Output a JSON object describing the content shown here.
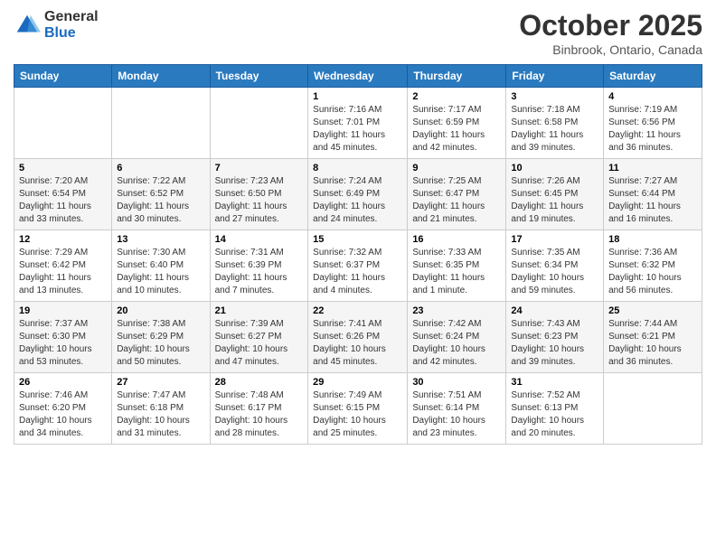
{
  "logo": {
    "general": "General",
    "blue": "Blue"
  },
  "title": "October 2025",
  "subtitle": "Binbrook, Ontario, Canada",
  "days_of_week": [
    "Sunday",
    "Monday",
    "Tuesday",
    "Wednesday",
    "Thursday",
    "Friday",
    "Saturday"
  ],
  "weeks": [
    [
      {
        "day": "",
        "info": ""
      },
      {
        "day": "",
        "info": ""
      },
      {
        "day": "",
        "info": ""
      },
      {
        "day": "1",
        "info": "Sunrise: 7:16 AM\nSunset: 7:01 PM\nDaylight: 11 hours and 45 minutes."
      },
      {
        "day": "2",
        "info": "Sunrise: 7:17 AM\nSunset: 6:59 PM\nDaylight: 11 hours and 42 minutes."
      },
      {
        "day": "3",
        "info": "Sunrise: 7:18 AM\nSunset: 6:58 PM\nDaylight: 11 hours and 39 minutes."
      },
      {
        "day": "4",
        "info": "Sunrise: 7:19 AM\nSunset: 6:56 PM\nDaylight: 11 hours and 36 minutes."
      }
    ],
    [
      {
        "day": "5",
        "info": "Sunrise: 7:20 AM\nSunset: 6:54 PM\nDaylight: 11 hours and 33 minutes."
      },
      {
        "day": "6",
        "info": "Sunrise: 7:22 AM\nSunset: 6:52 PM\nDaylight: 11 hours and 30 minutes."
      },
      {
        "day": "7",
        "info": "Sunrise: 7:23 AM\nSunset: 6:50 PM\nDaylight: 11 hours and 27 minutes."
      },
      {
        "day": "8",
        "info": "Sunrise: 7:24 AM\nSunset: 6:49 PM\nDaylight: 11 hours and 24 minutes."
      },
      {
        "day": "9",
        "info": "Sunrise: 7:25 AM\nSunset: 6:47 PM\nDaylight: 11 hours and 21 minutes."
      },
      {
        "day": "10",
        "info": "Sunrise: 7:26 AM\nSunset: 6:45 PM\nDaylight: 11 hours and 19 minutes."
      },
      {
        "day": "11",
        "info": "Sunrise: 7:27 AM\nSunset: 6:44 PM\nDaylight: 11 hours and 16 minutes."
      }
    ],
    [
      {
        "day": "12",
        "info": "Sunrise: 7:29 AM\nSunset: 6:42 PM\nDaylight: 11 hours and 13 minutes."
      },
      {
        "day": "13",
        "info": "Sunrise: 7:30 AM\nSunset: 6:40 PM\nDaylight: 11 hours and 10 minutes."
      },
      {
        "day": "14",
        "info": "Sunrise: 7:31 AM\nSunset: 6:39 PM\nDaylight: 11 hours and 7 minutes."
      },
      {
        "day": "15",
        "info": "Sunrise: 7:32 AM\nSunset: 6:37 PM\nDaylight: 11 hours and 4 minutes."
      },
      {
        "day": "16",
        "info": "Sunrise: 7:33 AM\nSunset: 6:35 PM\nDaylight: 11 hours and 1 minute."
      },
      {
        "day": "17",
        "info": "Sunrise: 7:35 AM\nSunset: 6:34 PM\nDaylight: 10 hours and 59 minutes."
      },
      {
        "day": "18",
        "info": "Sunrise: 7:36 AM\nSunset: 6:32 PM\nDaylight: 10 hours and 56 minutes."
      }
    ],
    [
      {
        "day": "19",
        "info": "Sunrise: 7:37 AM\nSunset: 6:30 PM\nDaylight: 10 hours and 53 minutes."
      },
      {
        "day": "20",
        "info": "Sunrise: 7:38 AM\nSunset: 6:29 PM\nDaylight: 10 hours and 50 minutes."
      },
      {
        "day": "21",
        "info": "Sunrise: 7:39 AM\nSunset: 6:27 PM\nDaylight: 10 hours and 47 minutes."
      },
      {
        "day": "22",
        "info": "Sunrise: 7:41 AM\nSunset: 6:26 PM\nDaylight: 10 hours and 45 minutes."
      },
      {
        "day": "23",
        "info": "Sunrise: 7:42 AM\nSunset: 6:24 PM\nDaylight: 10 hours and 42 minutes."
      },
      {
        "day": "24",
        "info": "Sunrise: 7:43 AM\nSunset: 6:23 PM\nDaylight: 10 hours and 39 minutes."
      },
      {
        "day": "25",
        "info": "Sunrise: 7:44 AM\nSunset: 6:21 PM\nDaylight: 10 hours and 36 minutes."
      }
    ],
    [
      {
        "day": "26",
        "info": "Sunrise: 7:46 AM\nSunset: 6:20 PM\nDaylight: 10 hours and 34 minutes."
      },
      {
        "day": "27",
        "info": "Sunrise: 7:47 AM\nSunset: 6:18 PM\nDaylight: 10 hours and 31 minutes."
      },
      {
        "day": "28",
        "info": "Sunrise: 7:48 AM\nSunset: 6:17 PM\nDaylight: 10 hours and 28 minutes."
      },
      {
        "day": "29",
        "info": "Sunrise: 7:49 AM\nSunset: 6:15 PM\nDaylight: 10 hours and 25 minutes."
      },
      {
        "day": "30",
        "info": "Sunrise: 7:51 AM\nSunset: 6:14 PM\nDaylight: 10 hours and 23 minutes."
      },
      {
        "day": "31",
        "info": "Sunrise: 7:52 AM\nSunset: 6:13 PM\nDaylight: 10 hours and 20 minutes."
      },
      {
        "day": "",
        "info": ""
      }
    ]
  ]
}
